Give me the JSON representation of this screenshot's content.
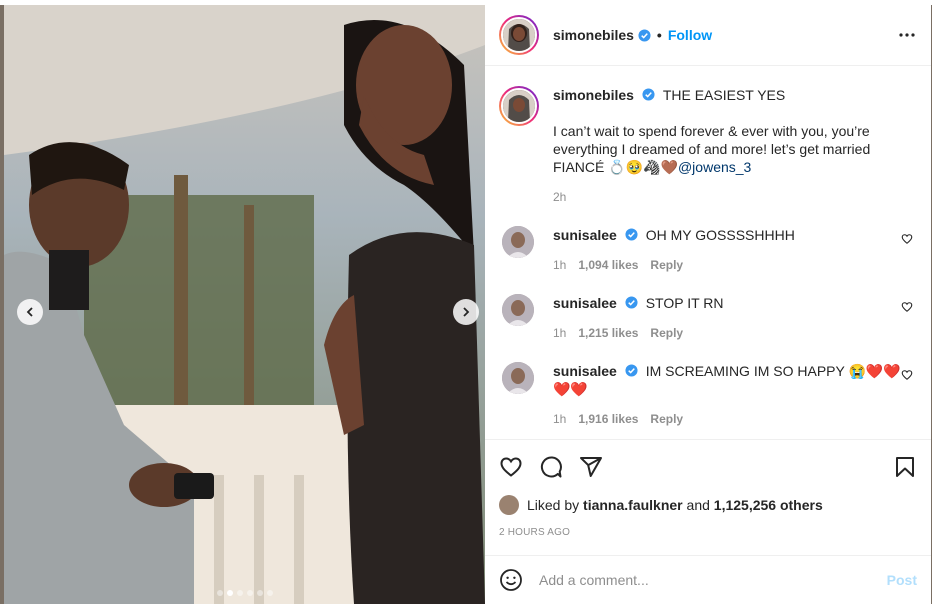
{
  "post": {
    "username": "simonebiles",
    "follow_label": "Follow",
    "separator": "•"
  },
  "caption": {
    "username": "simonebiles",
    "headline": "THE EASIEST YES",
    "body": "I can’t wait to spend forever & ever with you, you’re everything I dreamed of and more! let’s get married FIANCÉ 💍🥹🦓🤎",
    "mention": "@jowens_3",
    "age": "2h"
  },
  "comments": [
    {
      "username": "sunisalee",
      "text": "OH MY GOSSSSHHHH",
      "age": "1h",
      "likes": "1,094 likes",
      "reply": "Reply"
    },
    {
      "username": "sunisalee",
      "text": "STOP IT RN",
      "age": "1h",
      "likes": "1,215 likes",
      "reply": "Reply"
    },
    {
      "username": "sunisalee",
      "text": "IM SCREAMING IM SO HAPPY 😭❤️❤️❤️❤️",
      "age": "1h",
      "likes": "1,916 likes",
      "reply": "Reply"
    }
  ],
  "likes": {
    "prefix": "Liked by",
    "user": "tianna.faulkner",
    "conj": "and",
    "count": "1,125,256 others"
  },
  "timestamp": "2 HOURS AGO",
  "composer": {
    "placeholder": "Add a comment...",
    "post_label": "Post"
  },
  "carousel": {
    "slides": 6,
    "active_index": 1
  },
  "colors": {
    "accent": "#0095f6",
    "verified": "#3897f0"
  },
  "icons": [
    "chevron-left-icon",
    "chevron-right-icon",
    "verified-badge-icon",
    "more-icon",
    "heart-icon",
    "comment-icon",
    "share-icon",
    "bookmark-icon",
    "emoji-icon"
  ]
}
